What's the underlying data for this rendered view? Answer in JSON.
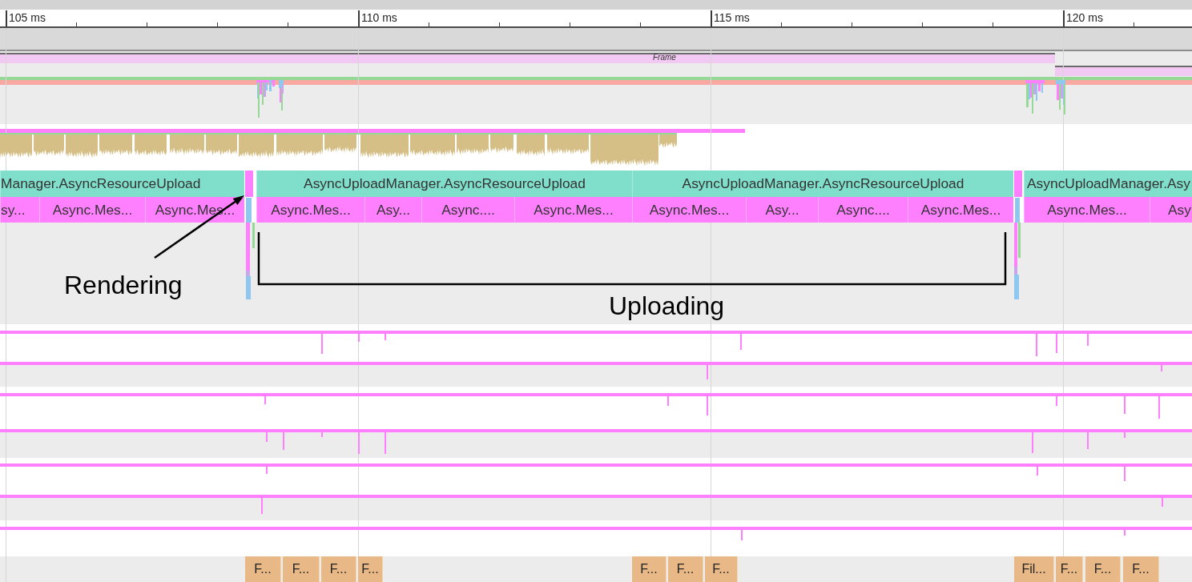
{
  "ruler": {
    "ticks": [
      "105 ms",
      "110 ms",
      "115 ms",
      "120 ms"
    ]
  },
  "frame_track": {
    "label": "Frame"
  },
  "upload_track": {
    "slices": [
      "Manager.AsyncResourceUpload",
      "AsyncUploadManager.AsyncResourceUpload",
      "AsyncUploadManager.AsyncResourceUpload",
      "AsyncUploadManager.Asy"
    ]
  },
  "message_track": {
    "slices": [
      "sy...",
      "Async.Mes...",
      "Async.Mes...",
      "Async.Mes...",
      "Asy...",
      "Async....",
      "Async.Mes...",
      "Async.Mes...",
      "Asy...",
      "Async....",
      "Async.Mes...",
      "Async.Mes...",
      "Asy"
    ]
  },
  "annotations": [
    {
      "kind": "arrow",
      "label": "Rendering"
    },
    {
      "kind": "bracket",
      "label": "Uploading"
    }
  ],
  "file_track": {
    "slices": [
      "F...",
      "F...",
      "F...",
      "F...",
      "F...",
      "F...",
      "F...",
      "Fil...",
      "F...",
      "F...",
      "F..."
    ]
  }
}
